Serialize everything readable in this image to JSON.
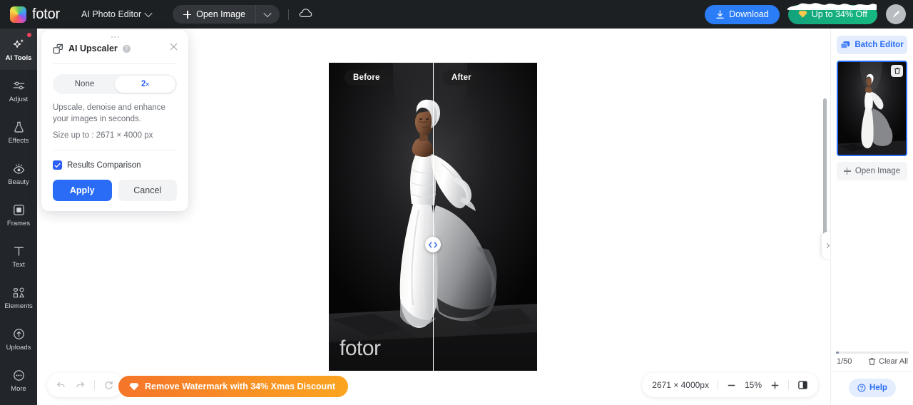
{
  "brand": {
    "name": "fotor",
    "logo_icon": "fotor-logo-icon"
  },
  "topbar": {
    "mode_label": "AI Photo Editor",
    "mode_caret_icon": "chevron-down-icon",
    "open_image_label": "Open Image",
    "open_image_plus_icon": "plus-icon",
    "open_image_caret_icon": "chevron-down-icon",
    "cloud_icon": "cloud-icon",
    "download_label": "Download",
    "download_icon": "download-icon",
    "download_color": "#2a7cf7",
    "promo_label": "Up to 34% Off",
    "promo_icon": "diamond-icon",
    "promo_color": "#16b981",
    "avatar_icon": "bird-avatar-icon"
  },
  "sidebar": {
    "items": [
      {
        "label": "AI Tools",
        "icon": "sparkle-icon",
        "active": true,
        "badge": true
      },
      {
        "label": "Adjust",
        "icon": "sliders-icon",
        "active": false,
        "badge": false
      },
      {
        "label": "Effects",
        "icon": "flask-icon",
        "active": false,
        "badge": false
      },
      {
        "label": "Beauty",
        "icon": "eye-icon",
        "active": false,
        "badge": false
      },
      {
        "label": "Frames",
        "icon": "frame-square-icon",
        "active": false,
        "badge": false
      },
      {
        "label": "Text",
        "icon": "text-t-icon",
        "active": false,
        "badge": false
      },
      {
        "label": "Elements",
        "icon": "shapes-icon",
        "active": false,
        "badge": false
      },
      {
        "label": "Uploads",
        "icon": "upload-cloud-icon",
        "active": false,
        "badge": false
      },
      {
        "label": "More",
        "icon": "ellipsis-circle-icon",
        "active": false,
        "badge": false
      }
    ]
  },
  "panel": {
    "title": "AI Upscaler",
    "icon": "upscale-icon",
    "help_icon": "question-mark-icon",
    "close_icon": "close-icon",
    "drag_icon": "drag-dots-icon",
    "scale_options": [
      {
        "label": "None",
        "selected": false
      },
      {
        "label": "2",
        "sup": "×",
        "selected": true
      }
    ],
    "description": "Upscale, denoise and enhance your images in seconds.",
    "size_note": "Size up to : 2671 × 4000 px",
    "comparison_label": "Results Comparison",
    "comparison_checked": true,
    "check_icon": "check-icon",
    "apply_label": "Apply",
    "cancel_label": "Cancel",
    "accent_color": "#2a5cf7"
  },
  "canvas": {
    "before_label": "Before",
    "after_label": "After",
    "watermark": "fotor",
    "split_handle_icon": "left-right-chevrons-icon",
    "collapse_icon": "chevron-right-icon"
  },
  "bottombar": {
    "undo_icon": "undo-arrow-icon",
    "redo_icon": "redo-arrow-icon",
    "reset_icon": "refresh-icon",
    "promo_label": "Remove Watermark with 34% Xmas Discount",
    "promo_icon": "diamond-icon",
    "promo_color": "#f5752a",
    "dimensions": "2671 × 4000px",
    "zoom_out_icon": "minus-icon",
    "zoom_level": "15%",
    "zoom_in_icon": "plus-icon",
    "compare_icon": "split-view-icon"
  },
  "right_panel": {
    "batch_editor_label": "Batch Editor",
    "batch_editor_icon": "layers-icon",
    "thumb_delete_icon": "trash-icon",
    "open_image_label": "Open Image",
    "open_image_icon": "plus-icon",
    "count_label": "1/50",
    "progress_percent": 2,
    "clear_all_label": "Clear All",
    "clear_all_icon": "trash-icon",
    "help_label": "Help",
    "help_icon": "question-circle-icon",
    "accent_color": "#2a6cf5"
  }
}
